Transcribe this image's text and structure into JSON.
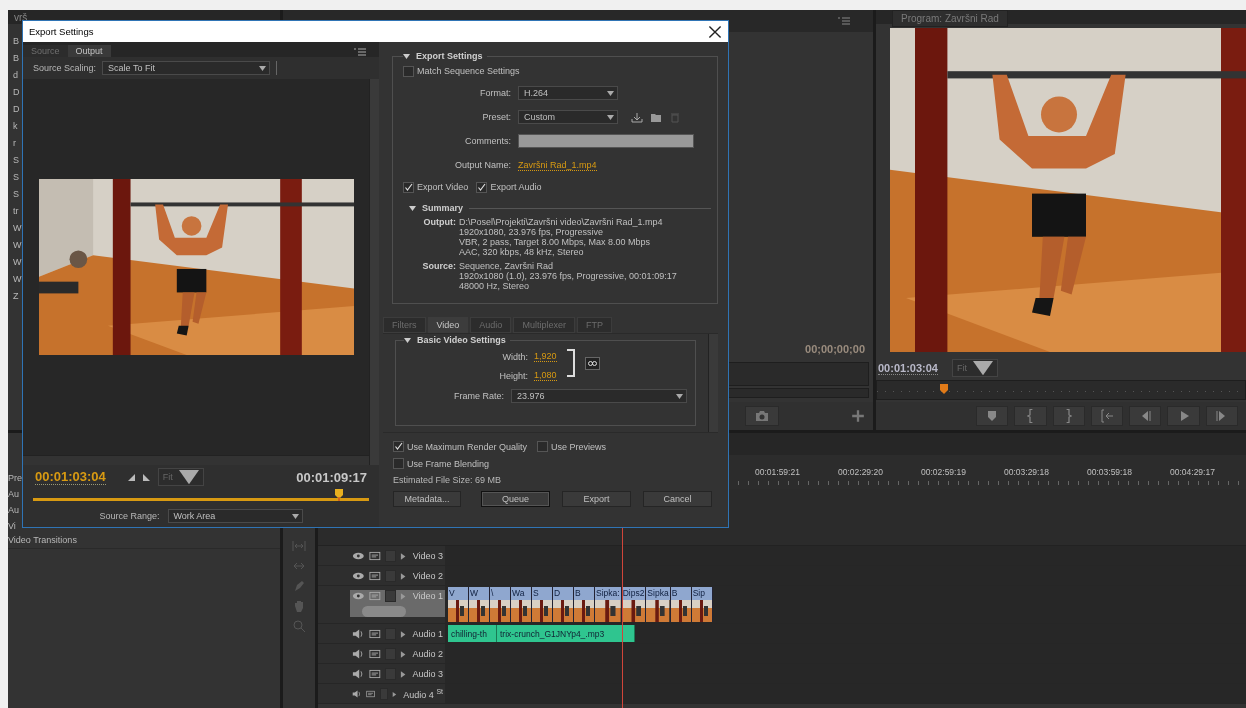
{
  "project_panel": {
    "header": "vrš",
    "items": [
      "B",
      "B",
      "d",
      "D",
      "D",
      "k",
      "r",
      "S",
      "S",
      "S",
      "tr",
      "W",
      "W",
      "W",
      "W",
      "Z"
    ]
  },
  "effects_panel": {
    "items": [
      "Pre",
      "Au",
      "Au",
      "Vi"
    ],
    "folder": "Video Transitions"
  },
  "source_monitor": {
    "timecode": "00;00;00;00"
  },
  "program_monitor": {
    "title": "Program: Završni Rad",
    "timecode": "00:01:03:04",
    "zoom": "Fit",
    "playhead": {
      "level": 0.17
    }
  },
  "timeline": {
    "ruler": [
      "00:01:59:21",
      "00:02:29:20",
      "00:02:59:19",
      "00:03:29:18",
      "00:03:59:18",
      "00:04:29:17"
    ],
    "tracks": [
      {
        "kind": "video",
        "name": "Video 3",
        "selected": false
      },
      {
        "kind": "video",
        "name": "Video 2",
        "selected": false
      },
      {
        "kind": "video",
        "name": "Video 1",
        "selected": true,
        "clips": [
          "V",
          "W",
          "\\",
          "Wa",
          "S",
          "D",
          "B",
          "Sipka:",
          "Dips2",
          "Sipka",
          "B",
          "Sip"
        ]
      },
      {
        "kind": "audio",
        "name": "Audio 1",
        "selected": false,
        "clips": [
          "chilling-th",
          "trix-crunch_G1JNYp4_.mp3"
        ]
      },
      {
        "kind": "audio",
        "name": "Audio 2",
        "selected": false
      },
      {
        "kind": "audio",
        "name": "Audio 3",
        "selected": false
      },
      {
        "kind": "audio",
        "name": "Audio 4",
        "selected": false,
        "badge": "St"
      }
    ]
  },
  "export_dialog": {
    "title": "Export Settings",
    "left_tabs": [
      {
        "label": "Source",
        "selected": false
      },
      {
        "label": "Output",
        "selected": true
      }
    ],
    "source_scaling": {
      "label": "Source Scaling:",
      "value": "Scale To Fit"
    },
    "current_time": "00:01:03:04",
    "zoom": "Fit",
    "duration": "00:01:09:17",
    "playhead": {
      "level": 0.91
    },
    "source_range": {
      "label": "Source Range:",
      "value": "Work Area"
    },
    "export_settings": {
      "heading": "Export Settings",
      "match_sequence": {
        "label": "Match Sequence Settings",
        "checked": false
      },
      "fields": [
        {
          "kind": "dropdown",
          "label": "Format:",
          "value": "H.264"
        },
        {
          "kind": "preset",
          "label": "Preset:",
          "value": "Custom"
        },
        {
          "kind": "text",
          "label": "Comments:"
        },
        {
          "kind": "link",
          "label": "Output Name:",
          "value": "Završni Rad_1.mp4"
        }
      ],
      "exports": [
        {
          "label": "Export Video",
          "checked": true
        },
        {
          "label": "Export Audio",
          "checked": true
        }
      ],
      "summary": {
        "heading": "Summary",
        "entries": [
          {
            "label": "Output:",
            "lines": [
              "D:\\Posel\\Projekti\\Završni video\\Završni Rad_1.mp4",
              "1920x1080, 23.976 fps, Progressive",
              "VBR, 2 pass, Target 8.00 Mbps, Max 8.00 Mbps",
              "AAC, 320 kbps, 48 kHz, Stereo"
            ]
          },
          {
            "label": "Source:",
            "lines": [
              "Sequence, Završni Rad",
              "1920x1080 (1.0), 23.976 fps, Progressive, 00:01:09:17",
              "48000 Hz, Stereo"
            ]
          }
        ]
      }
    },
    "tabs": [
      {
        "label": "Filters",
        "selected": false
      },
      {
        "label": "Video",
        "selected": true
      },
      {
        "label": "Audio",
        "selected": false
      },
      {
        "label": "Multiplexer",
        "selected": false
      },
      {
        "label": "FTP",
        "selected": false
      }
    ],
    "basic_video": {
      "heading": "Basic Video Settings",
      "width": {
        "label": "Width:",
        "value": "1,920"
      },
      "height": {
        "label": "Height:",
        "value": "1,080"
      },
      "frame_rate": {
        "label": "Frame Rate:",
        "value": "23.976"
      }
    },
    "options": [
      {
        "label": "Use Maximum Render Quality",
        "checked": true
      },
      {
        "label": "Use Previews",
        "checked": false
      },
      {
        "label": "Use Frame Blending",
        "checked": false
      }
    ],
    "file_size": {
      "label": "Estimated File Size:",
      "value": "69 MB"
    },
    "buttons": [
      {
        "label": "Metadata...",
        "focused": false
      },
      {
        "label": "Queue",
        "focused": true
      },
      {
        "label": "Export",
        "focused": false
      },
      {
        "label": "Cancel",
        "focused": false
      }
    ]
  }
}
